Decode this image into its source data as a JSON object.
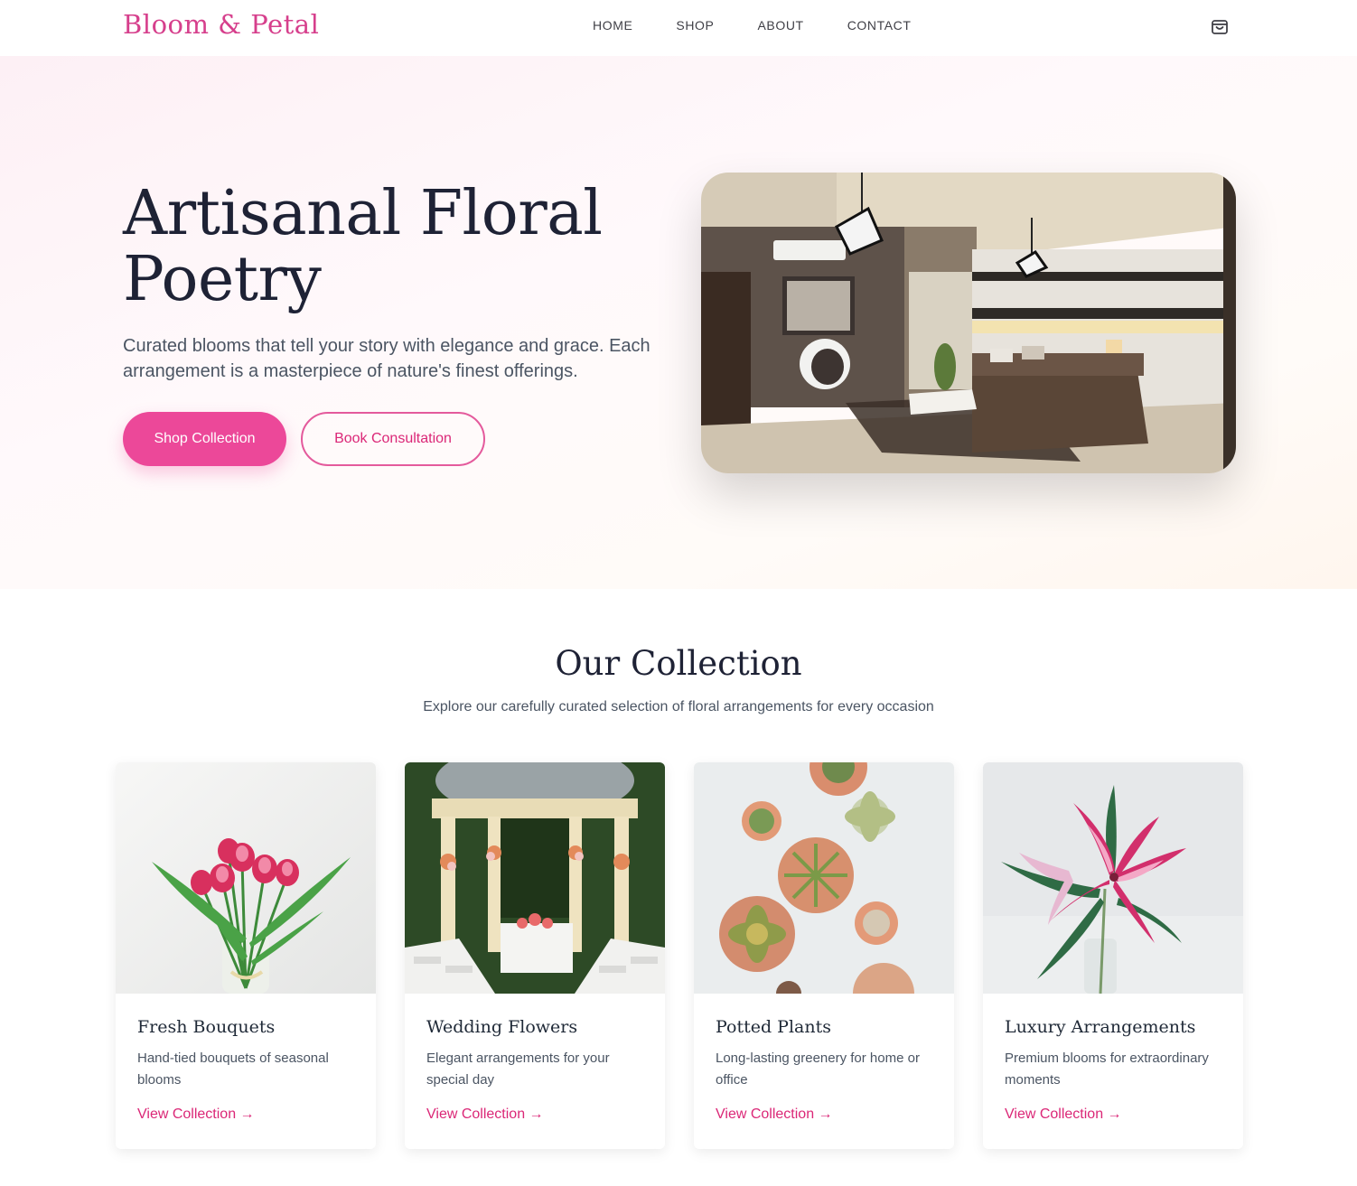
{
  "brand": {
    "logo": "Bloom & Petal"
  },
  "nav": {
    "links": [
      {
        "label": "HOME"
      },
      {
        "label": "SHOP"
      },
      {
        "label": "ABOUT"
      },
      {
        "label": "CONTACT"
      }
    ],
    "cart_icon": "shopping-bag-icon"
  },
  "hero": {
    "title": "Artisanal Floral Poetry",
    "subtitle": "Curated blooms that tell your story with elegance and grace. Each arrangement is a masterpiece of nature's finest offerings.",
    "primary_button": "Shop Collection",
    "secondary_button": "Book Consultation"
  },
  "collection": {
    "title": "Our Collection",
    "subtitle": "Explore our carefully curated selection of floral arrangements for every occasion",
    "cards": [
      {
        "title": "Fresh Bouquets",
        "description": "Hand-tied bouquets of seasonal blooms",
        "link": "View Collection →"
      },
      {
        "title": "Wedding Flowers",
        "description": "Elegant arrangements for your special day",
        "link": "View Collection →"
      },
      {
        "title": "Potted Plants",
        "description": "Long-lasting greenery for home or office",
        "link": "View Collection →"
      },
      {
        "title": "Luxury Arrangements",
        "description": "Premium blooms for extraordinary moments",
        "link": "View Collection →"
      }
    ]
  },
  "colors": {
    "accent": "#ec4899",
    "accent_text": "#db2777",
    "heading": "#1e2235",
    "body": "#4b5563"
  }
}
